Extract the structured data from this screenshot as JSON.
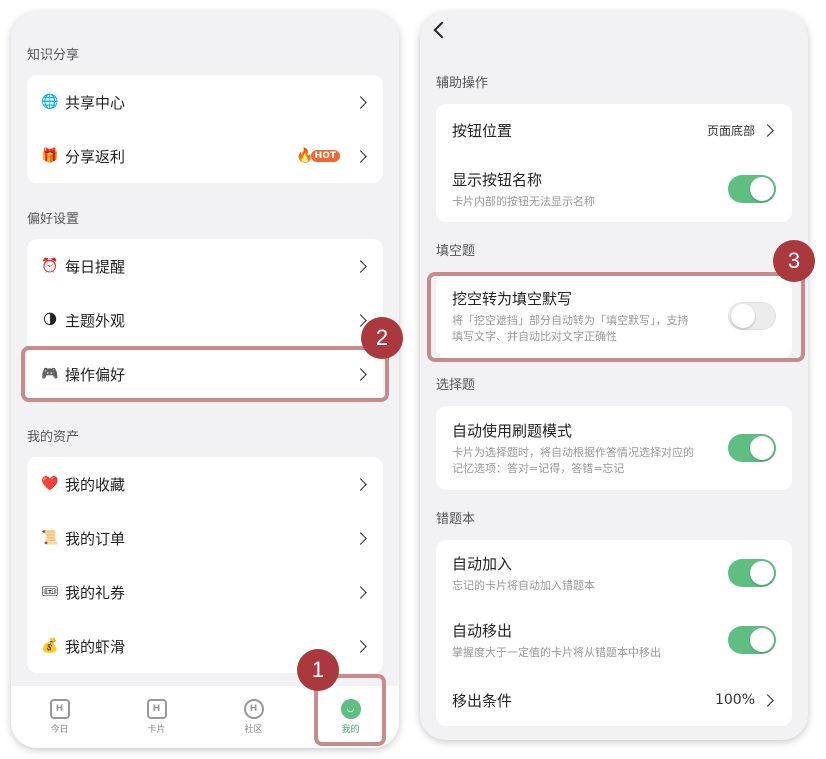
{
  "left": {
    "sections": [
      {
        "title": "知识分享",
        "items": [
          {
            "icon": "globe-icon",
            "glyph": "🌐",
            "label": "共享中心"
          },
          {
            "icon": "gift-icon",
            "glyph": "🎁",
            "label": "分享返利",
            "badge": "HOT"
          }
        ]
      },
      {
        "title": "偏好设置",
        "items": [
          {
            "icon": "alarm-clock-icon",
            "glyph": "⏰",
            "label": "每日提醒"
          },
          {
            "icon": "moon-icon",
            "glyph": "🌗",
            "label": "主题外观"
          },
          {
            "icon": "gamepad-icon",
            "glyph": "🎮",
            "label": "操作偏好"
          }
        ]
      },
      {
        "title": "我的资产",
        "items": [
          {
            "icon": "heart-icon",
            "glyph": "❤️",
            "label": "我的收藏"
          },
          {
            "icon": "scroll-icon",
            "glyph": "📜",
            "label": "我的订单"
          },
          {
            "icon": "ticket-icon",
            "glyph": "🎟",
            "label": "我的礼券"
          },
          {
            "icon": "money-bag-icon",
            "glyph": "💰",
            "label": "我的虾滑"
          }
        ]
      }
    ],
    "tabs": [
      {
        "label": "今日",
        "icon": "calendar-icon"
      },
      {
        "label": "卡片",
        "icon": "card-icon"
      },
      {
        "label": "社区",
        "icon": "community-icon"
      },
      {
        "label": "我的",
        "icon": "smile-icon",
        "active": true
      }
    ],
    "markers": {
      "one": "1",
      "two": "2"
    }
  },
  "right": {
    "sections": {
      "assist": "辅助操作",
      "fill": "填空题",
      "choice": "选择题",
      "wrong": "错题本"
    },
    "assist": {
      "button_position": {
        "title": "按钮位置",
        "value": "页面底部"
      },
      "show_names": {
        "title": "显示按钮名称",
        "desc": "卡片内部的按钮无法显示名称",
        "on": true
      }
    },
    "fill": {
      "convert": {
        "title": "挖空转为填空默写",
        "desc1": "将「挖空遮挡」部分自动转为「填空默写」，支持",
        "desc2": "填写文字、并自动比对文字正确性",
        "on": false
      }
    },
    "choice": {
      "auto_mode": {
        "title": "自动使用刷题模式",
        "desc1": "卡片为选择题时，将自动根据作答情况选择对应的",
        "desc2": "记忆选项：答对=记得，答错=忘记",
        "on": true
      }
    },
    "wrong": {
      "auto_add": {
        "title": "自动加入",
        "desc": "忘记的卡片将自动加入错题本",
        "on": true
      },
      "auto_remove": {
        "title": "自动移出",
        "desc": "掌握度大于一定值的卡片将从错题本中移出",
        "on": true
      },
      "condition": {
        "title": "移出条件",
        "value": "100%"
      }
    },
    "markers": {
      "three": "3"
    }
  },
  "colors": {
    "accent": "#5fbf83",
    "highlight": "#c98a8c",
    "badge": "#a9393c",
    "hot": "#ec6a32"
  }
}
